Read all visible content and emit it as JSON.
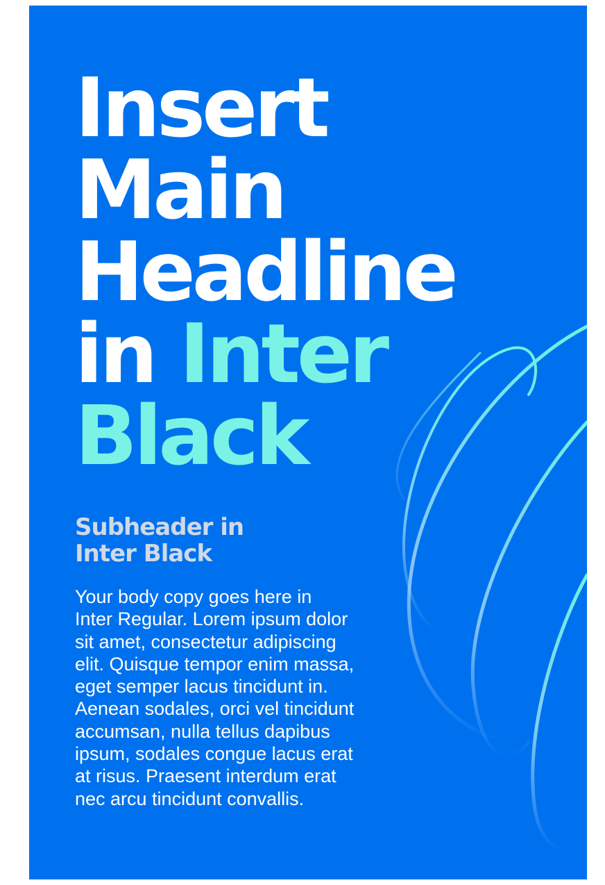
{
  "poster": {
    "background": "#0071ee",
    "headline": {
      "lines": [
        "Insert",
        "Main",
        "Headline"
      ],
      "line4_prefix": "in ",
      "line4_accent": "Inter",
      "line5_accent": "Black",
      "color": "#ffffff",
      "accent_color": "#7af3e6"
    },
    "subheader": {
      "lines": [
        "Subheader in",
        "Inter Black"
      ],
      "color": "#cfd9e8"
    },
    "body": {
      "lines": [
        "Your body copy goes here in",
        "Inter Regular. Lorem ipsum dolor",
        "sit amet, consectetur adipiscing",
        "elit. Quisque tempor enim massa,",
        "eget semper lacus tincidunt in.",
        "Aenean sodales, orci vel tincidunt",
        "accumsan, nulla tellus dapibus",
        "ipsum, sodales congue lacus erat",
        "at risus. Praesent interdum erat",
        "nec arcu tincidunt convallis."
      ],
      "color": "#ffffff"
    },
    "decoration": {
      "name": "swirl-lines",
      "colors": [
        "#6ff0e2",
        "#a8ccff"
      ]
    }
  }
}
